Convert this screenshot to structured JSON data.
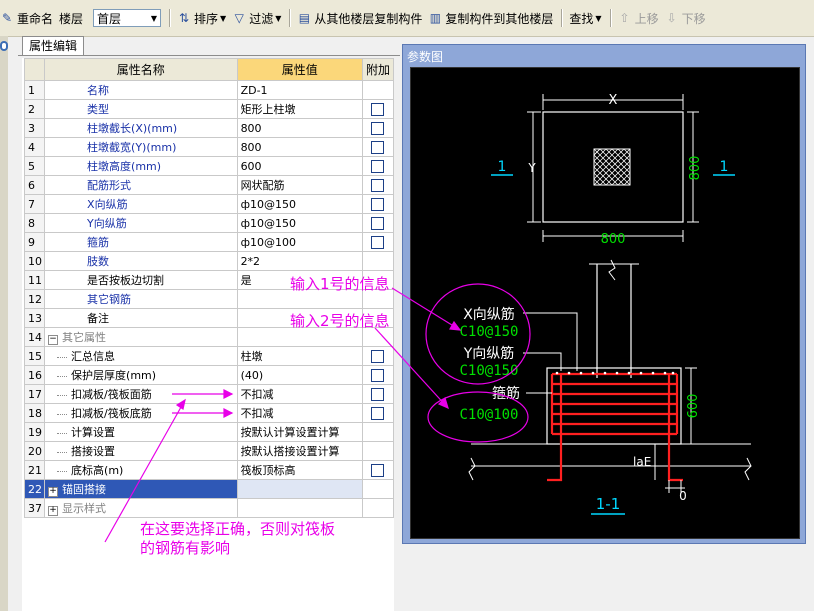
{
  "toolbar": {
    "rename": "重命名",
    "floor_label": "楼层",
    "floor_value": "首层",
    "sort": "排序",
    "filter": "过滤",
    "copy_from": "从其他楼层复制构件",
    "copy_to": "复制构件到其他楼层",
    "find": "查找",
    "move_up": "上移",
    "move_down": "下移"
  },
  "tab": {
    "label": "属性编辑"
  },
  "grid": {
    "headers": {
      "name": "属性名称",
      "value": "属性值",
      "extra": "附加"
    },
    "rows": [
      {
        "n": "1",
        "name": "名称",
        "value": "ZD-1",
        "chk": false,
        "style": "blue"
      },
      {
        "n": "2",
        "name": "类型",
        "value": "矩形上柱墩",
        "chk": true,
        "style": "blue"
      },
      {
        "n": "3",
        "name": "柱墩截长(X)(mm)",
        "value": "800",
        "chk": true,
        "style": "blue"
      },
      {
        "n": "4",
        "name": "柱墩截宽(Y)(mm)",
        "value": "800",
        "chk": true,
        "style": "blue"
      },
      {
        "n": "5",
        "name": "柱墩高度(mm)",
        "value": "600",
        "chk": true,
        "style": "blue"
      },
      {
        "n": "6",
        "name": "配筋形式",
        "value": "网状配筋",
        "chk": true,
        "style": "blue"
      },
      {
        "n": "7",
        "name": "X向纵筋",
        "value": "ф10@150",
        "chk": true,
        "style": "blue"
      },
      {
        "n": "8",
        "name": "Y向纵筋",
        "value": "ф10@150",
        "chk": true,
        "style": "blue"
      },
      {
        "n": "9",
        "name": "箍筋",
        "value": "ф10@100",
        "chk": true,
        "style": "blue"
      },
      {
        "n": "10",
        "name": "肢数",
        "value": "2*2",
        "chk": false,
        "style": "blue"
      },
      {
        "n": "11",
        "name": "是否按板边切割",
        "value": "是",
        "chk": false,
        "style": "black"
      },
      {
        "n": "12",
        "name": "其它钢筋",
        "value": "",
        "chk": false,
        "style": "blue"
      },
      {
        "n": "13",
        "name": "备注",
        "value": "",
        "chk": false,
        "style": "black"
      },
      {
        "n": "14",
        "name": "其它属性",
        "value": "",
        "chk": false,
        "style": "group"
      },
      {
        "n": "15",
        "name": "汇总信息",
        "value": "柱墩",
        "chk": true,
        "style": "child"
      },
      {
        "n": "16",
        "name": "保护层厚度(mm)",
        "value": "(40)",
        "chk": true,
        "style": "child"
      },
      {
        "n": "17",
        "name": "扣减板/筏板面筋",
        "value": "不扣减",
        "chk": true,
        "style": "child"
      },
      {
        "n": "18",
        "name": "扣减板/筏板底筋",
        "value": "不扣减",
        "chk": true,
        "style": "child"
      },
      {
        "n": "19",
        "name": "计算设置",
        "value": "按默认计算设置计算",
        "chk": false,
        "style": "child"
      },
      {
        "n": "20",
        "name": "搭接设置",
        "value": "按默认搭接设置计算",
        "chk": false,
        "style": "child"
      },
      {
        "n": "21",
        "name": "底标高(m)",
        "value": "筏板顶标高",
        "chk": true,
        "style": "child"
      },
      {
        "n": "22",
        "name": "锚固搭接",
        "value": "",
        "chk": false,
        "style": "selected"
      },
      {
        "n": "37",
        "name": "显示样式",
        "value": "",
        "chk": false,
        "style": "collapsed"
      }
    ]
  },
  "ref": {
    "title": "参数图",
    "dim_x": "X",
    "dim_y": "Y",
    "dim_800_h": "800",
    "dim_800_v": "800",
    "section_mark": "1",
    "x_bar_label": "X向纵筋",
    "x_bar_value": "C10@150",
    "y_bar_label": "Y向纵筋",
    "y_bar_value": "C10@150",
    "stirrup_label": "箍筋",
    "stirrup_value": "C10@100",
    "dim_600": "600",
    "lae": "laE",
    "zero": "0",
    "section_title": "1-1"
  },
  "annotations": {
    "note1": "输入1号的信息",
    "note2": "输入2号的信息",
    "bottom_note_line1": "在这要选择正确，否则对筏板",
    "bottom_note_line2": "的钢筋有影响"
  },
  "colors": {
    "annotation": "#e800e8",
    "cad_white": "#ffffff",
    "cad_green": "#00e000",
    "cad_cyan": "#00d8ff",
    "cad_red": "#ff2020"
  }
}
